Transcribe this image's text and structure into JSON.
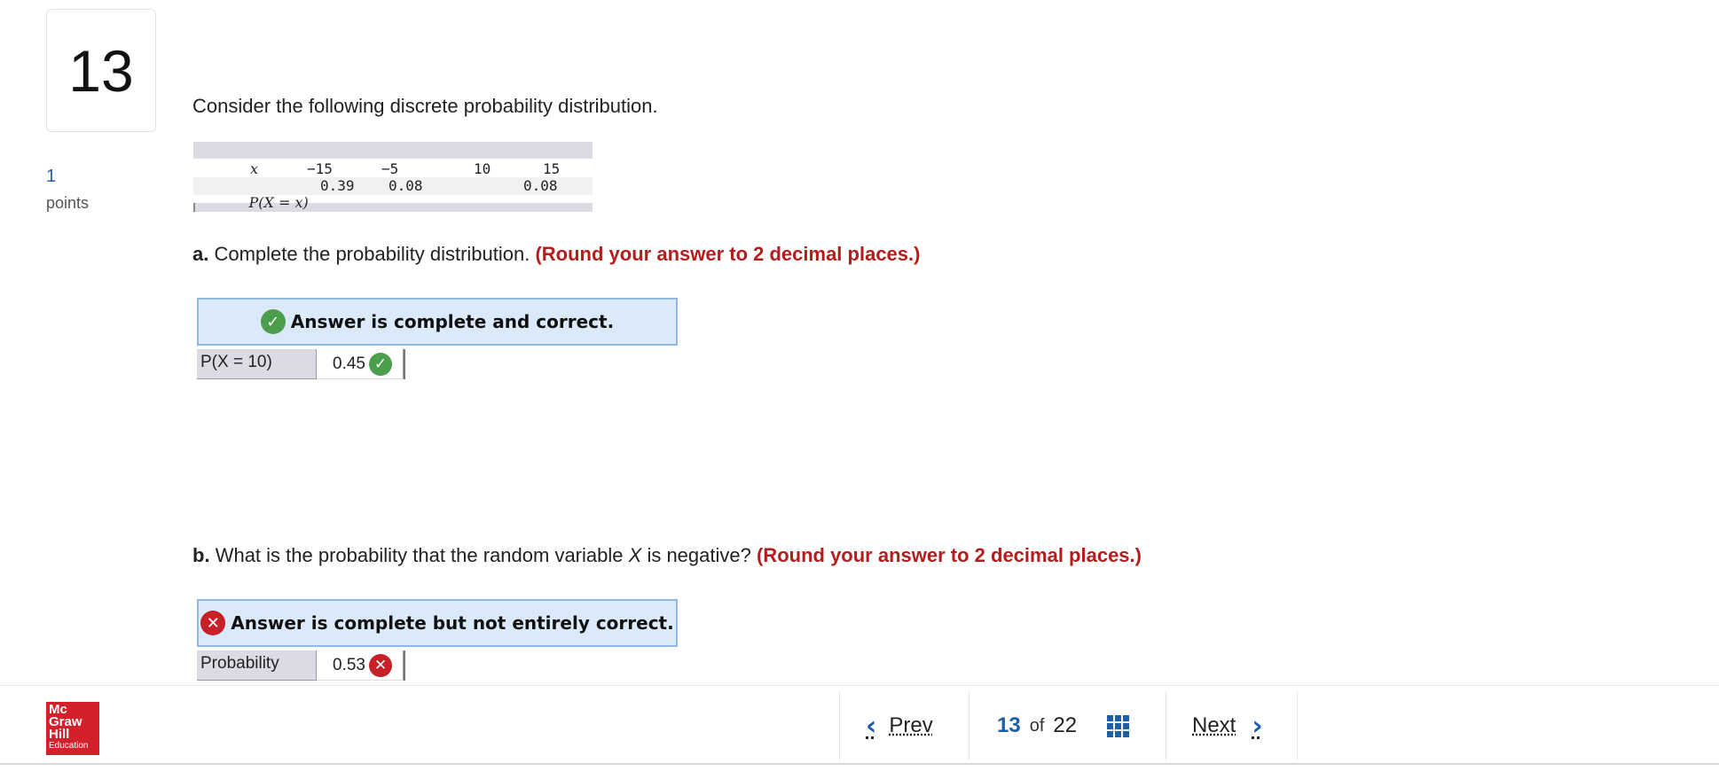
{
  "question": {
    "number": "13",
    "points_value": "1",
    "points_label": "points",
    "prompt": "Consider the following discrete probability distribution."
  },
  "dist_table": {
    "x_header": "x",
    "p_header": "P(X = x)",
    "x_values": [
      "−15",
      "−5",
      "10",
      "15"
    ],
    "p_values": [
      "0.39",
      "0.08",
      "",
      "0.08"
    ]
  },
  "part_a": {
    "label": "a.",
    "text": "Complete the probability distribution.",
    "hint": "(Round your answer to 2 decimal places.)",
    "banner": "Answer is complete and correct.",
    "row_label": "P(X = 10)",
    "row_value": "0.45",
    "status_icon": "check-icon"
  },
  "part_b": {
    "label": "b.",
    "text_before": "What is the probability that the random variable",
    "var": "X",
    "text_after": "is negative?",
    "hint": "(Round your answer to 2 decimal places.)",
    "banner": "Answer is complete but not entirely correct.",
    "row_label": "Probability",
    "row_value": "0.53",
    "status_icon": "x-icon"
  },
  "footer": {
    "logo": {
      "line1": "Mc",
      "line2": "Graw",
      "line3": "Hill",
      "line4": "Education"
    },
    "prev_label": "Prev",
    "next_label": "Next",
    "current_page": "13",
    "of_label": "of",
    "total_pages": "22"
  },
  "colors": {
    "accent": "#1d5fa8",
    "hint": "#b51d1d",
    "correct": "#4a9e4c",
    "incorrect": "#c72027",
    "banner_bg": "#dbeafa"
  }
}
